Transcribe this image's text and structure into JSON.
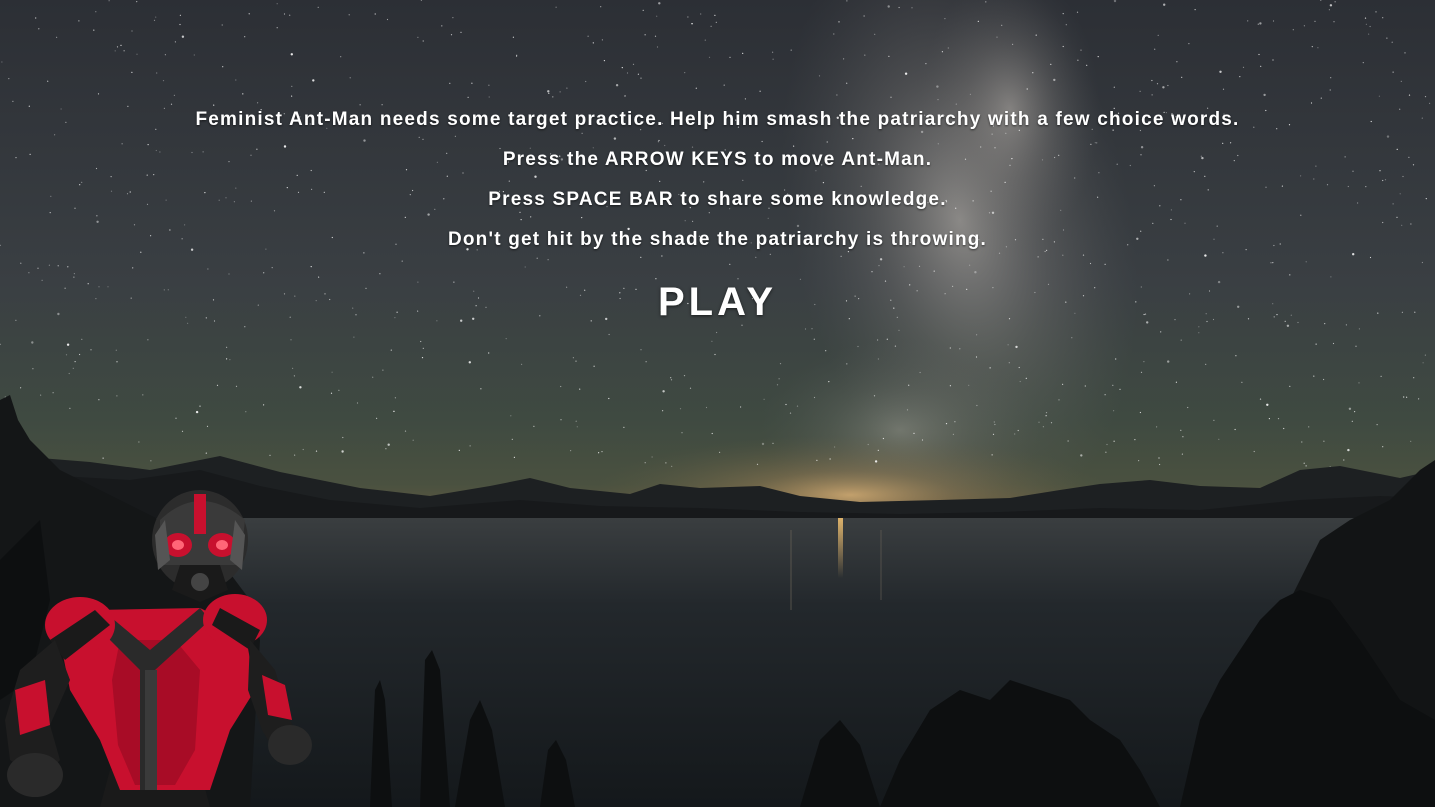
{
  "game": {
    "intro": [
      "Feminist Ant-Man needs some target practice. Help him smash the patriarchy with a few choice words.",
      "Press the ARROW KEYS to move Ant-Man.",
      "Press SPACE BAR to share some knowledge.",
      "Don't get hit by the shade the patriarchy is throwing."
    ],
    "play_label": "PLAY"
  },
  "scene": {
    "background": "night-sky-lake",
    "player_sprite": "ant-man",
    "colors": {
      "text": "#ffffff",
      "suit_red": "#c8102e",
      "suit_black": "#1a1a1a",
      "water": "#1b2026"
    }
  }
}
